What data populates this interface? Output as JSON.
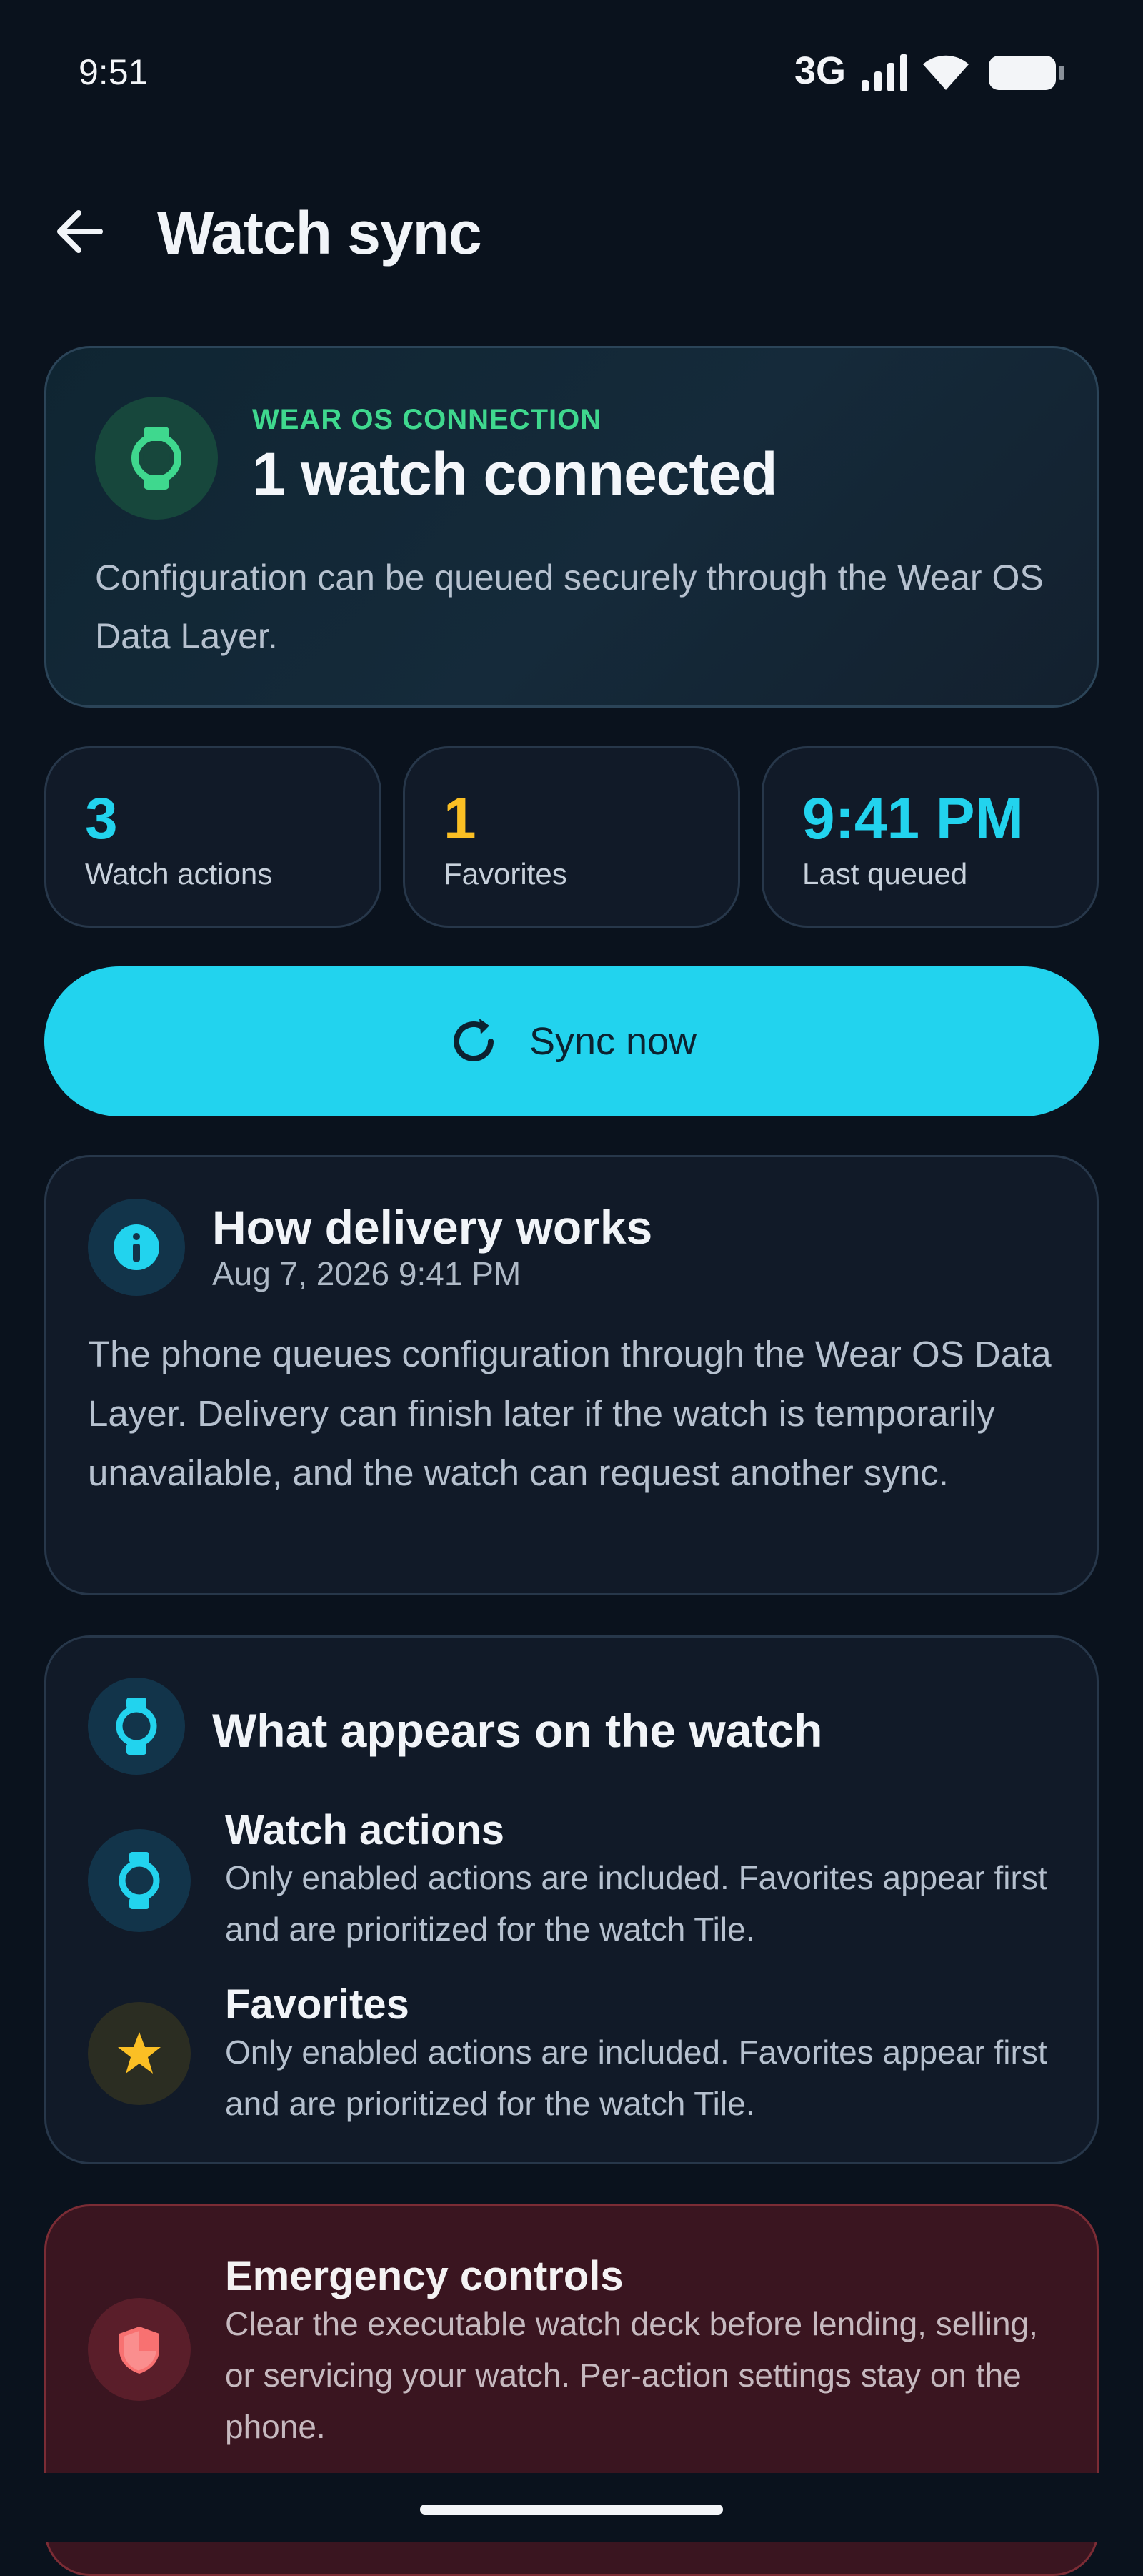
{
  "status_bar": {
    "time": "9:51",
    "network": "3G"
  },
  "header": {
    "title": "Watch sync"
  },
  "connection": {
    "label": "WEAR OS CONNECTION",
    "title": "1 watch connected",
    "description": "Configuration can be queued securely through the Wear OS Data Layer."
  },
  "stats": [
    {
      "value": "3",
      "label": "Watch actions",
      "color": "#22d3ee"
    },
    {
      "value": "1",
      "label": "Favorites",
      "color": "#fbbf24"
    },
    {
      "value": "9:41 PM",
      "label": "Last queued",
      "color": "#22d3ee"
    }
  ],
  "sync_button": {
    "label": "Sync now"
  },
  "delivery": {
    "title": "How delivery works",
    "date": "Aug 7, 2026 9:41 PM",
    "description": "The phone queues configuration through the Wear OS Data Layer. Delivery can finish later if the watch is temporarily unavailable, and the watch can request another sync."
  },
  "appears": {
    "title": "What appears on the watch",
    "items": [
      {
        "title": "Watch actions",
        "description": "Only enabled actions are included. Favorites appear first and are prioritized for the watch Tile."
      },
      {
        "title": "Favorites",
        "description": "Only enabled actions are included. Favorites appear first and are prioritized for the watch Tile."
      }
    ]
  },
  "emergency": {
    "title": "Emergency controls",
    "description": "Clear the executable watch deck before lending, selling, or servicing your watch. Per-action settings stay on the phone."
  },
  "colors": {
    "accent": "#22d3ee",
    "success": "#3fd88e",
    "favorite": "#fbbf24",
    "danger": "#f87171",
    "background": "#0a121d"
  },
  "icons": {
    "back": "arrow-left-icon",
    "connection": "watch-icon",
    "sync": "refresh-icon",
    "info": "info-icon",
    "watch": "watch-icon",
    "favorite": "star-icon",
    "emergency": "shield-icon"
  }
}
